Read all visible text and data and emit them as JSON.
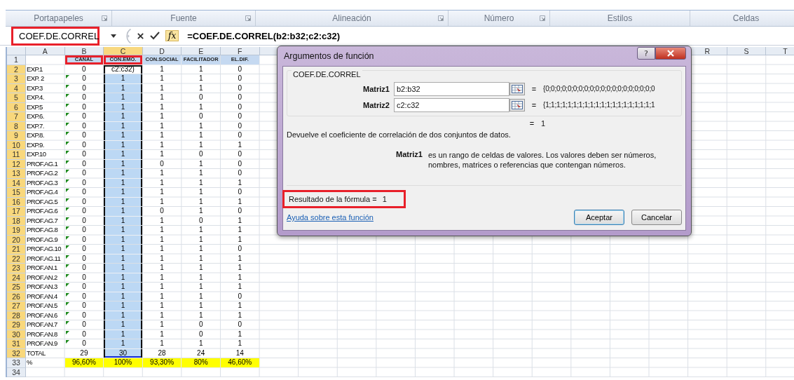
{
  "ribbon_groups": [
    {
      "label": "Portapapeles",
      "launcher": true
    },
    {
      "label": "Fuente",
      "launcher": true
    },
    {
      "label": "Alineación",
      "launcher": true
    },
    {
      "label": "Número",
      "launcher": true
    },
    {
      "label": "Estilos",
      "launcher": false
    },
    {
      "label": "Celdas",
      "launcher": false
    }
  ],
  "formula_bar": {
    "name_box": "COEF.DE.CORREL",
    "name_box_marked": true,
    "insert_function": "fx",
    "formula": "=COEF.DE.CORREL(b2:b32;c2:c32)"
  },
  "sheet": {
    "columns": [
      {
        "letter": "A",
        "selected": false
      },
      {
        "letter": "B",
        "selected": false
      },
      {
        "letter": "C",
        "selected": true
      },
      {
        "letter": "D",
        "selected": false
      },
      {
        "letter": "E",
        "selected": false
      },
      {
        "letter": "F",
        "selected": false
      },
      {
        "letter": "R",
        "selected": false
      },
      {
        "letter": "S",
        "selected": false
      },
      {
        "letter": "T",
        "selected": false
      }
    ],
    "rows": [
      {
        "number": "1",
        "kind": "header",
        "selected": false,
        "flag": false,
        "marked": [
          false,
          true,
          true,
          false,
          false,
          false
        ],
        "cells": [
          null,
          "CANAL",
          "CON.EMO.",
          "CON.SOCIAL",
          "FACILITADOR",
          "EL.DIF."
        ]
      },
      {
        "number": "2",
        "kind": "data",
        "selected": true,
        "flag": false,
        "cells": [
          "EXP.1",
          "0",
          "c2:c32)",
          "1",
          "1",
          "0"
        ]
      },
      {
        "number": "3",
        "kind": "data",
        "selected": true,
        "flag": true,
        "cells": [
          "EXP. 2",
          "0",
          "1",
          "1",
          "1",
          "0"
        ]
      },
      {
        "number": "4",
        "kind": "data",
        "selected": true,
        "flag": true,
        "cells": [
          "EXP.3",
          "0",
          "1",
          "1",
          "1",
          "0"
        ]
      },
      {
        "number": "5",
        "kind": "data",
        "selected": true,
        "flag": true,
        "cells": [
          "EXP.4.",
          "0",
          "1",
          "1",
          "0",
          "0"
        ]
      },
      {
        "number": "6",
        "kind": "data",
        "selected": true,
        "flag": true,
        "cells": [
          "EXP.5",
          "0",
          "1",
          "1",
          "1",
          "0"
        ]
      },
      {
        "number": "7",
        "kind": "data",
        "selected": true,
        "flag": true,
        "cells": [
          "EXP.6.",
          "0",
          "1",
          "1",
          "0",
          "0"
        ]
      },
      {
        "number": "8",
        "kind": "data",
        "selected": true,
        "flag": true,
        "cells": [
          "EXP.7.",
          "0",
          "1",
          "1",
          "1",
          "0"
        ]
      },
      {
        "number": "9",
        "kind": "data",
        "selected": true,
        "flag": true,
        "cells": [
          "EXP.8.",
          "0",
          "1",
          "1",
          "1",
          "0"
        ]
      },
      {
        "number": "10",
        "kind": "data",
        "selected": true,
        "flag": true,
        "cells": [
          "EXP.9.",
          "0",
          "1",
          "1",
          "1",
          "1"
        ]
      },
      {
        "number": "11",
        "kind": "data",
        "selected": true,
        "flag": true,
        "cells": [
          "EXP.10",
          "0",
          "1",
          "1",
          "0",
          "0"
        ]
      },
      {
        "number": "12",
        "kind": "data",
        "selected": true,
        "flag": true,
        "cells": [
          "PROF.AG.1",
          "0",
          "1",
          "0",
          "1",
          "0"
        ]
      },
      {
        "number": "13",
        "kind": "data",
        "selected": true,
        "flag": true,
        "cells": [
          "PROF.AG.2",
          "0",
          "1",
          "1",
          "1",
          "0"
        ]
      },
      {
        "number": "14",
        "kind": "data",
        "selected": true,
        "flag": true,
        "cells": [
          "PROF.AG.3",
          "0",
          "1",
          "1",
          "1",
          "1"
        ]
      },
      {
        "number": "15",
        "kind": "data",
        "selected": true,
        "flag": true,
        "cells": [
          "PROF.AG.4",
          "0",
          "1",
          "1",
          "1",
          "0"
        ]
      },
      {
        "number": "16",
        "kind": "data",
        "selected": true,
        "flag": true,
        "cells": [
          "PROF.AG.5",
          "0",
          "1",
          "1",
          "1",
          "1"
        ]
      },
      {
        "number": "17",
        "kind": "data",
        "selected": true,
        "flag": true,
        "cells": [
          "PROF.AG.6",
          "0",
          "1",
          "0",
          "1",
          "0"
        ]
      },
      {
        "number": "18",
        "kind": "data",
        "selected": true,
        "flag": true,
        "cells": [
          "PROF.AG.7",
          "0",
          "1",
          "1",
          "0",
          "1"
        ]
      },
      {
        "number": "19",
        "kind": "data",
        "selected": true,
        "flag": true,
        "cells": [
          "PROF.AG.8",
          "0",
          "1",
          "1",
          "1",
          "1"
        ]
      },
      {
        "number": "20",
        "kind": "data",
        "selected": true,
        "flag": true,
        "cells": [
          "PROF.AG.9",
          "0",
          "1",
          "1",
          "1",
          "1"
        ]
      },
      {
        "number": "21",
        "kind": "data",
        "selected": true,
        "flag": true,
        "cells": [
          "PROF.AG.10",
          "0",
          "1",
          "1",
          "1",
          "0"
        ]
      },
      {
        "number": "22",
        "kind": "data",
        "selected": true,
        "flag": true,
        "cells": [
          "PROF.AG.11",
          "0",
          "1",
          "1",
          "1",
          "1"
        ]
      },
      {
        "number": "23",
        "kind": "data",
        "selected": true,
        "flag": true,
        "cells": [
          "PROF.AN.1",
          "0",
          "1",
          "1",
          "1",
          "1"
        ]
      },
      {
        "number": "24",
        "kind": "data",
        "selected": true,
        "flag": true,
        "cells": [
          "PROF.AN.2",
          "0",
          "1",
          "1",
          "1",
          "1"
        ]
      },
      {
        "number": "25",
        "kind": "data",
        "selected": true,
        "flag": true,
        "cells": [
          "PROF.AN.3",
          "0",
          "1",
          "1",
          "1",
          "1"
        ]
      },
      {
        "number": "26",
        "kind": "data",
        "selected": true,
        "flag": true,
        "cells": [
          "PROF.AN.4",
          "0",
          "1",
          "1",
          "1",
          "0"
        ]
      },
      {
        "number": "27",
        "kind": "data",
        "selected": true,
        "flag": true,
        "cells": [
          "PROF.AN.5",
          "0",
          "1",
          "1",
          "1",
          "1"
        ]
      },
      {
        "number": "28",
        "kind": "data",
        "selected": true,
        "flag": true,
        "cells": [
          "PROF.AN.6",
          "0",
          "1",
          "1",
          "1",
          "1"
        ]
      },
      {
        "number": "29",
        "kind": "data",
        "selected": true,
        "flag": true,
        "cells": [
          "PROF.AN.7",
          "0",
          "1",
          "1",
          "0",
          "0"
        ]
      },
      {
        "number": "30",
        "kind": "data",
        "selected": true,
        "flag": true,
        "cells": [
          "PROF.AN.8",
          "0",
          "1",
          "1",
          "0",
          "1"
        ]
      },
      {
        "number": "31",
        "kind": "data",
        "selected": true,
        "flag": true,
        "cells": [
          "PROF.AN.9",
          "0",
          "1",
          "1",
          "1",
          "1"
        ]
      },
      {
        "number": "32",
        "kind": "data",
        "selected": true,
        "flag": false,
        "cells": [
          "TOTAL",
          "29",
          "30",
          "28",
          "24",
          "14"
        ]
      },
      {
        "number": "33",
        "kind": "percent",
        "selected": false,
        "flag": false,
        "cells": [
          "%",
          "96,60%",
          "100%",
          "93,30%",
          "80%",
          "46,60%"
        ]
      },
      {
        "number": "34",
        "selected": false
      }
    ]
  },
  "dialog": {
    "title": "Argumentos de función",
    "help": "?",
    "function": "COEF.DE.CORREL",
    "args": [
      {
        "label": "Matriz1",
        "value": "b2:b32",
        "equals": "=",
        "preview": "{0;0;0;0;0;0;0;0;0;0;0;0;0;0;0;0;0;0;0;0"
      },
      {
        "label": "Matriz2",
        "value": "c2:c32",
        "equals": "=",
        "preview": "{1;1;1;1;1;1;1;1;1;1;1;1;1;1;1;1;1;1;1;1"
      }
    ],
    "total_equals": "=",
    "total": "1",
    "description": "Devuelve el coeficiente de correlación de dos conjuntos de datos.",
    "arg_help": {
      "name": "Matriz1",
      "text": "es un rango de celdas de valores. Los valores deben ser números, nombres, matrices o referencias que contengan números."
    },
    "result": {
      "label": "Resultado de la fórmula =",
      "value": "1",
      "marked": true
    },
    "help_link": "Ayuda sobre esta función",
    "buttons": [
      {
        "label": "Aceptar",
        "default": true
      },
      {
        "label": "Cancelar",
        "default": false
      }
    ]
  }
}
